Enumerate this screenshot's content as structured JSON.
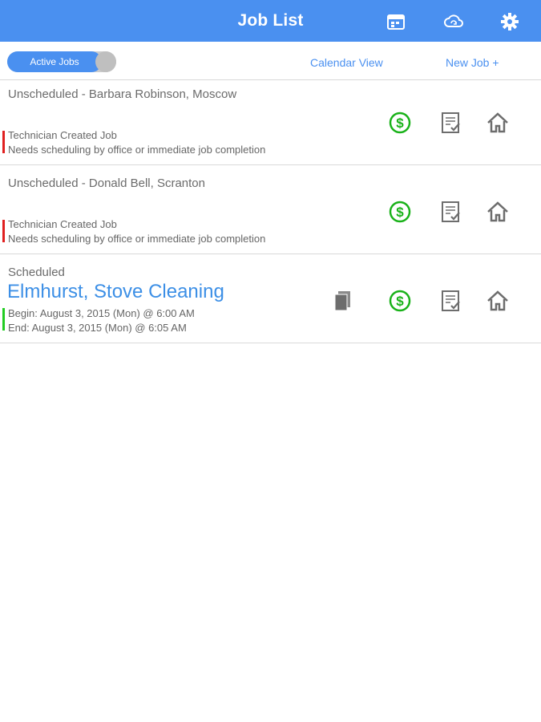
{
  "header": {
    "title": "Job List",
    "icons": [
      "calendar-icon",
      "cloud-sync-icon",
      "gear-icon"
    ]
  },
  "toolbar": {
    "toggle_label": "Active Jobs",
    "calendar_view": "Calendar View",
    "new_job": "New Job +"
  },
  "jobs": [
    {
      "status": "Unscheduled - Barbara Robinson, Moscow",
      "line1": "Technician Created Job",
      "line2": "Needs scheduling by office or immediate job completion",
      "bar_color": "#e02020"
    },
    {
      "status": "Unscheduled - Donald Bell, Scranton",
      "line1": "Technician Created Job",
      "line2": "Needs scheduling by office or immediate job completion",
      "bar_color": "#e02020"
    },
    {
      "status": "Scheduled",
      "title": "Elmhurst, Stove Cleaning",
      "line1": "Begin: August 3, 2015 (Mon) @ 6:00 AM",
      "line2": "End: August 3, 2015 (Mon) @ 6:05 AM",
      "bar_color": "#22cc22"
    }
  ],
  "colors": {
    "accent": "#4a90f0",
    "dollar": "#19b219",
    "icon_gray": "#6d6d6d"
  }
}
